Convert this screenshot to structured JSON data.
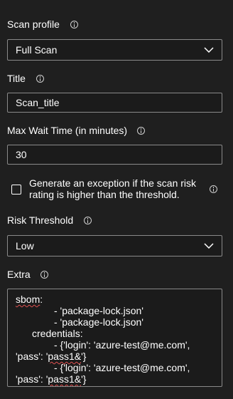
{
  "scan_profile": {
    "label": "Scan profile",
    "value": "Full Scan"
  },
  "title_field": {
    "label": "Title",
    "value": "Scan_title"
  },
  "max_wait": {
    "label": "Max Wait Time (in minutes)",
    "value": "30"
  },
  "exception_checkbox": {
    "label_line1": "Generate an exception if the scan risk",
    "label_line2": "rating is higher than the threshold.",
    "checked": false
  },
  "risk_threshold": {
    "label": "Risk Threshold",
    "value": "Low"
  },
  "extra": {
    "label": "Extra",
    "lines": {
      "l1_a": "sbom",
      "l1_b": ":",
      "l2": "- 'package-lock.json'",
      "l3": "- 'package-lock.json'",
      "l4": "credentials:",
      "l5": "- {'login': 'azure-test@me.com',",
      "l6_a": "'pass': '",
      "l6_b": "pass1&",
      "l6_c": "'}",
      "l7": "- {'login': 'azure-test@me.com',",
      "l8_a": "'pass': '",
      "l8_b": "pass1&",
      "l8_c": "'}"
    }
  },
  "icons": {
    "info": "info-circle-icon",
    "dropdown": "chevron-down-icon"
  },
  "colors": {
    "background": "#1f1f1f",
    "field_border": "#8a8a8a",
    "text": "#ffffff",
    "spellcheck": "#e05050"
  }
}
